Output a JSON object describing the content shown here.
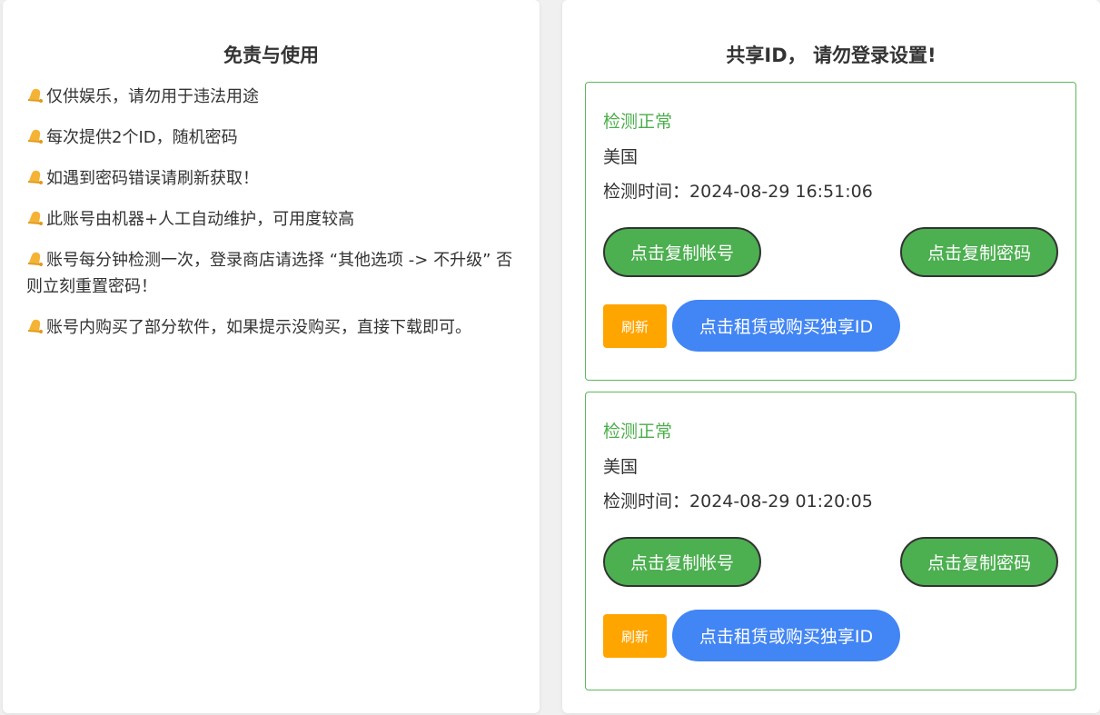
{
  "colors": {
    "success": "#4caf50",
    "status_text": "#4cae4c",
    "refresh": "#ffa500",
    "rent": "#4285f4",
    "card_border": "#5cb85c"
  },
  "left_panel": {
    "title": "免责与使用",
    "icon": "bell-icon",
    "items": [
      "仅供娱乐，请勿用于违法用途",
      "每次提供2个ID，随机密码",
      "如遇到密码错误请刷新获取！",
      "此账号由机器+人工自动维护，可用度较高",
      "账号每分钟检测一次，登录商店请选择 “其他选项 -> 不升级” 否则立刻重置密码！",
      "账号内购买了部分软件，如果提示没购买，直接下载即可。"
    ]
  },
  "right_panel": {
    "title": "共享ID， 请勿登录设置!",
    "cards": [
      {
        "status": "检测正常",
        "country": "美国",
        "time_label": "检测时间：",
        "time_value": "2024-08-29 16:51:06",
        "copy_account_label": "点击复制帐号",
        "copy_password_label": "点击复制密码",
        "refresh_label": "刷新",
        "rent_label": "点击租赁或购买独享ID"
      },
      {
        "status": "检测正常",
        "country": "美国",
        "time_label": "检测时间：",
        "time_value": "2024-08-29 01:20:05",
        "copy_account_label": "点击复制帐号",
        "copy_password_label": "点击复制密码",
        "refresh_label": "刷新",
        "rent_label": "点击租赁或购买独享ID"
      }
    ]
  }
}
